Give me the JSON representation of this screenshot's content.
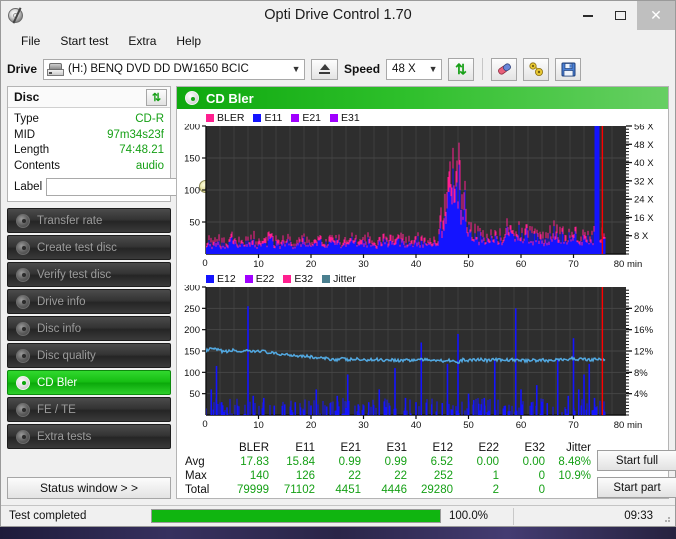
{
  "window": {
    "title": "Opti Drive Control 1.70",
    "icon": "disc-icon",
    "minimize": "–",
    "maximize": "□",
    "close": "✕"
  },
  "menu": {
    "items": [
      "File",
      "Start test",
      "Extra",
      "Help"
    ]
  },
  "toolbar": {
    "drive_label": "Drive",
    "drive_value": "(H:)   BENQ DVD DD DW1650 BCIC",
    "drive_icon": "drive-icon",
    "eject_icon": "eject-icon",
    "speed_label": "Speed",
    "speed_value": "48 X",
    "refresh_icon": "refresh-icon",
    "eraser_icon": "eraser-icon",
    "tools_icon": "tools-icon",
    "save_icon": "save-icon",
    "dropdown_arrow": "▼"
  },
  "disc_panel": {
    "title": "Disc",
    "refresh_icon": "refresh-icon",
    "rows": [
      {
        "key": "Type",
        "value": "CD-R"
      },
      {
        "key": "MID",
        "value": "97m34s23f"
      },
      {
        "key": "Length",
        "value": "74:48.21"
      },
      {
        "key": "Contents",
        "value": "audio"
      }
    ],
    "label_key": "Label",
    "label_value": "",
    "label_placeholder": "",
    "label_button_icon": "cd-icon"
  },
  "sidebar": {
    "items": [
      {
        "label": "Transfer rate",
        "active": false
      },
      {
        "label": "Create test disc",
        "active": false
      },
      {
        "label": "Verify test disc",
        "active": false
      },
      {
        "label": "Drive info",
        "active": false
      },
      {
        "label": "Disc info",
        "active": false
      },
      {
        "label": "Disc quality",
        "active": false
      },
      {
        "label": "CD Bler",
        "active": true
      },
      {
        "label": "FE / TE",
        "active": false
      },
      {
        "label": "Extra tests",
        "active": false
      }
    ],
    "status_window_button": "Status window > >"
  },
  "chart_panel": {
    "title": "CD Bler",
    "icon": "disc-icon"
  },
  "chart_data": [
    {
      "type": "area",
      "id": "bler-chart",
      "title": "CD Bler",
      "xlabel": "80 min",
      "ylabel": "",
      "xlim": [
        0,
        80
      ],
      "ylim": [
        0,
        200
      ],
      "y2lim": [
        0,
        56
      ],
      "y2label": "X",
      "xticks": [
        0,
        10,
        20,
        30,
        40,
        50,
        60,
        70
      ],
      "x_axis_end_label": "80 min",
      "yticks": [
        50,
        100,
        150,
        200
      ],
      "y2ticks": [
        "8 X",
        "16 X",
        "24 X",
        "32 X",
        "40 X",
        "48 X",
        "56 X"
      ],
      "grid": true,
      "legend_position": "top-left",
      "legend": [
        {
          "name": "BLER",
          "color": "#ff1f8f"
        },
        {
          "name": "E11",
          "color": "#1414ff"
        },
        {
          "name": "E21",
          "color": "#a000ff"
        },
        {
          "name": "E31",
          "color": "#a000ff"
        }
      ],
      "series": [
        {
          "name": "BLER",
          "color": "#ff1f8f",
          "x": [
            0,
            1,
            2,
            3,
            4,
            5,
            6,
            7,
            8,
            9,
            10,
            11,
            12,
            13,
            14,
            15,
            16,
            17,
            18,
            19,
            20,
            21,
            22,
            23,
            24,
            25,
            26,
            27,
            28,
            29,
            30,
            31,
            32,
            33,
            34,
            35,
            36,
            37,
            38,
            39,
            40,
            41,
            42,
            43,
            44,
            45,
            46,
            47,
            47.5,
            48,
            48.5,
            49,
            49.5,
            50,
            50.5,
            51,
            52,
            53,
            54,
            55,
            56,
            57,
            58,
            59,
            60,
            61,
            62,
            63,
            64,
            65,
            66,
            67,
            68,
            69,
            70,
            71,
            72,
            73,
            74,
            75
          ],
          "values": [
            22,
            20,
            24,
            18,
            21,
            25,
            19,
            23,
            20,
            26,
            18,
            22,
            24,
            20,
            19,
            23,
            21,
            18,
            25,
            20,
            22,
            19,
            24,
            21,
            20,
            23,
            18,
            22,
            25,
            19,
            21,
            24,
            20,
            18,
            23,
            22,
            19,
            25,
            21,
            20,
            24,
            22,
            19,
            21,
            30,
            55,
            88,
            125,
            140,
            132,
            118,
            95,
            72,
            58,
            46,
            40,
            34,
            30,
            28,
            26,
            30,
            34,
            45,
            38,
            32,
            36,
            30,
            34,
            28,
            32,
            38,
            30,
            34,
            28,
            32,
            30,
            26,
            24,
            30
          ]
        },
        {
          "name": "E11",
          "color": "#1414ff",
          "x": [
            0,
            1,
            2,
            3,
            4,
            5,
            6,
            7,
            8,
            9,
            10,
            11,
            12,
            13,
            14,
            15,
            16,
            17,
            18,
            19,
            20,
            21,
            22,
            23,
            24,
            25,
            26,
            27,
            28,
            29,
            30,
            31,
            32,
            33,
            34,
            35,
            36,
            37,
            38,
            39,
            40,
            41,
            42,
            43,
            44,
            45,
            46,
            47,
            47.5,
            48,
            48.5,
            49,
            49.5,
            50,
            50.5,
            51,
            52,
            53,
            54,
            55,
            56,
            57,
            58,
            59,
            60,
            61,
            62,
            63,
            64,
            65,
            66,
            67,
            68,
            69,
            70,
            71,
            72,
            73,
            74,
            75
          ],
          "values": [
            16,
            15,
            18,
            13,
            16,
            19,
            14,
            17,
            15,
            20,
            13,
            16,
            18,
            15,
            14,
            17,
            16,
            13,
            19,
            15,
            16,
            14,
            18,
            16,
            15,
            17,
            13,
            16,
            19,
            14,
            16,
            18,
            15,
            13,
            17,
            16,
            14,
            19,
            16,
            15,
            18,
            16,
            14,
            16,
            22,
            42,
            68,
            100,
            112,
            106,
            95,
            78,
            60,
            48,
            38,
            33,
            28,
            25,
            23,
            21,
            24,
            27,
            34,
            30,
            26,
            28,
            24,
            27,
            22,
            25,
            29,
            24,
            27,
            22,
            25,
            24,
            21,
            19,
            24
          ]
        },
        {
          "name": "E21",
          "color": "#a000ff",
          "x": [
            0,
            10,
            20,
            30,
            40,
            45,
            48,
            50,
            55,
            60,
            65,
            70,
            75
          ],
          "values": [
            1,
            1,
            1,
            1,
            1,
            2,
            5,
            3,
            1,
            1,
            1,
            1,
            1
          ]
        },
        {
          "name": "E31",
          "color": "#a000ff",
          "x": [
            0,
            10,
            20,
            30,
            40,
            45,
            48,
            50,
            55,
            60,
            65,
            70,
            75
          ],
          "values": [
            1,
            1,
            1,
            1,
            1,
            2,
            5,
            3,
            1,
            1,
            1,
            1,
            1
          ]
        }
      ],
      "scan_marker_x": 75.5,
      "scan_marker_color": "#ff0000"
    },
    {
      "type": "line",
      "id": "jitter-chart",
      "title": "Jitter / E12 / E22 / E32",
      "xlabel": "80 min",
      "xlim": [
        0,
        80
      ],
      "ylim": [
        0,
        300
      ],
      "y2lim": [
        0,
        20
      ],
      "y2label": "%",
      "xticks": [
        0,
        10,
        20,
        30,
        40,
        50,
        60,
        70
      ],
      "x_axis_end_label": "80 min",
      "yticks": [
        50,
        100,
        150,
        200,
        250,
        300
      ],
      "y2ticks": [
        "4%",
        "8%",
        "12%",
        "16%",
        "20%"
      ],
      "grid": true,
      "legend_position": "top-left",
      "legend": [
        {
          "name": "E12",
          "color": "#1414ff"
        },
        {
          "name": "E22",
          "color": "#a000ff"
        },
        {
          "name": "E32",
          "color": "#ff1f8f"
        },
        {
          "name": "Jitter",
          "color": "#4a9ac0"
        }
      ],
      "series": [
        {
          "name": "Jitter",
          "color": "#52a8e0",
          "x": [
            0,
            1,
            2,
            3,
            4,
            5,
            6,
            7,
            8,
            9,
            10,
            11,
            12,
            13,
            14,
            15,
            16,
            17,
            18,
            19,
            20,
            21,
            22,
            23,
            24,
            25,
            26,
            27,
            28,
            29,
            30,
            31,
            32,
            33,
            34,
            35,
            36,
            37,
            38,
            39,
            40,
            41,
            42,
            43,
            44,
            45,
            46,
            47,
            48,
            49,
            50,
            51,
            52,
            53,
            54,
            55,
            56,
            57,
            58,
            59,
            60,
            61,
            62,
            63,
            64,
            65,
            66,
            67,
            68,
            69,
            70,
            71,
            72,
            73,
            74,
            75
          ],
          "values": [
            150,
            155,
            153,
            150,
            148,
            152,
            150,
            147,
            150,
            148,
            151,
            149,
            146,
            144,
            142,
            143,
            141,
            140,
            139,
            138,
            136,
            134,
            133,
            132,
            131,
            130,
            132,
            129,
            130,
            131,
            128,
            130,
            129,
            131,
            128,
            130,
            129,
            127,
            130,
            128,
            129,
            131,
            128,
            130,
            129,
            127,
            129,
            128,
            121,
            130,
            128,
            129,
            131,
            129,
            128,
            130,
            129,
            128,
            130,
            128,
            129,
            127,
            130,
            128,
            129,
            127,
            129,
            131,
            128,
            130,
            133,
            130,
            132,
            129,
            131,
            130
          ],
          "unit": "left-scale",
          "approx_percent": 8.48
        },
        {
          "name": "E12",
          "color": "#1414ff",
          "description": "narrow vertical spikes along the baseline",
          "x": [
            1,
            2,
            3,
            4,
            6,
            8,
            9,
            11,
            13,
            15,
            17,
            18,
            20,
            21,
            23,
            25,
            27,
            29,
            31,
            33,
            35,
            36,
            38,
            40,
            41,
            43,
            45,
            46,
            48,
            50,
            51,
            53,
            55,
            57,
            59,
            60,
            62,
            63,
            65,
            67,
            69,
            70,
            71,
            72,
            73,
            74
          ],
          "values": [
            60,
            115,
            30,
            18,
            22,
            255,
            45,
            40,
            22,
            25,
            30,
            18,
            22,
            60,
            20,
            45,
            95,
            25,
            30,
            60,
            22,
            110,
            40,
            30,
            170,
            25,
            28,
            120,
            190,
            50,
            35,
            40,
            130,
            22,
            250,
            60,
            30,
            70,
            28,
            130,
            45,
            180,
            60,
            95,
            120,
            40
          ]
        },
        {
          "name": "E22",
          "color": "#a000ff",
          "x": [
            30,
            60
          ],
          "values": [
            1,
            1
          ]
        },
        {
          "name": "E32",
          "color": "#ff1f8f",
          "x": [],
          "values": []
        }
      ],
      "scan_marker_x": 75.5,
      "scan_marker_color": "#ff0000"
    }
  ],
  "stats": {
    "columns": [
      "BLER",
      "E11",
      "E21",
      "E31",
      "E12",
      "E22",
      "E32",
      "Jitter"
    ],
    "rows": [
      {
        "label": "Avg",
        "values": [
          "17.83",
          "15.84",
          "0.99",
          "0.99",
          "6.52",
          "0.00",
          "0.00",
          "8.48%"
        ]
      },
      {
        "label": "Max",
        "values": [
          "140",
          "126",
          "22",
          "22",
          "252",
          "1",
          "0",
          "10.9%"
        ]
      },
      {
        "label": "Total",
        "values": [
          "79999",
          "71102",
          "4451",
          "4446",
          "29280",
          "2",
          "0",
          ""
        ]
      }
    ]
  },
  "actions": {
    "start_full": "Start full",
    "start_part": "Start part"
  },
  "statusbar": {
    "message": "Test completed",
    "progress_percent": 100,
    "progress_text": "100.0%",
    "elapsed": "09:33"
  },
  "colors": {
    "accent_green": "#0ea80e",
    "value_green": "#16a016",
    "bler_magenta": "#ff1f8f",
    "e11_blue": "#1414ff",
    "e21_purple": "#a000ff",
    "jitter_teal": "#4a9ac0",
    "marker_red": "#ff0000",
    "plot_bg": "#2e2e2e"
  }
}
